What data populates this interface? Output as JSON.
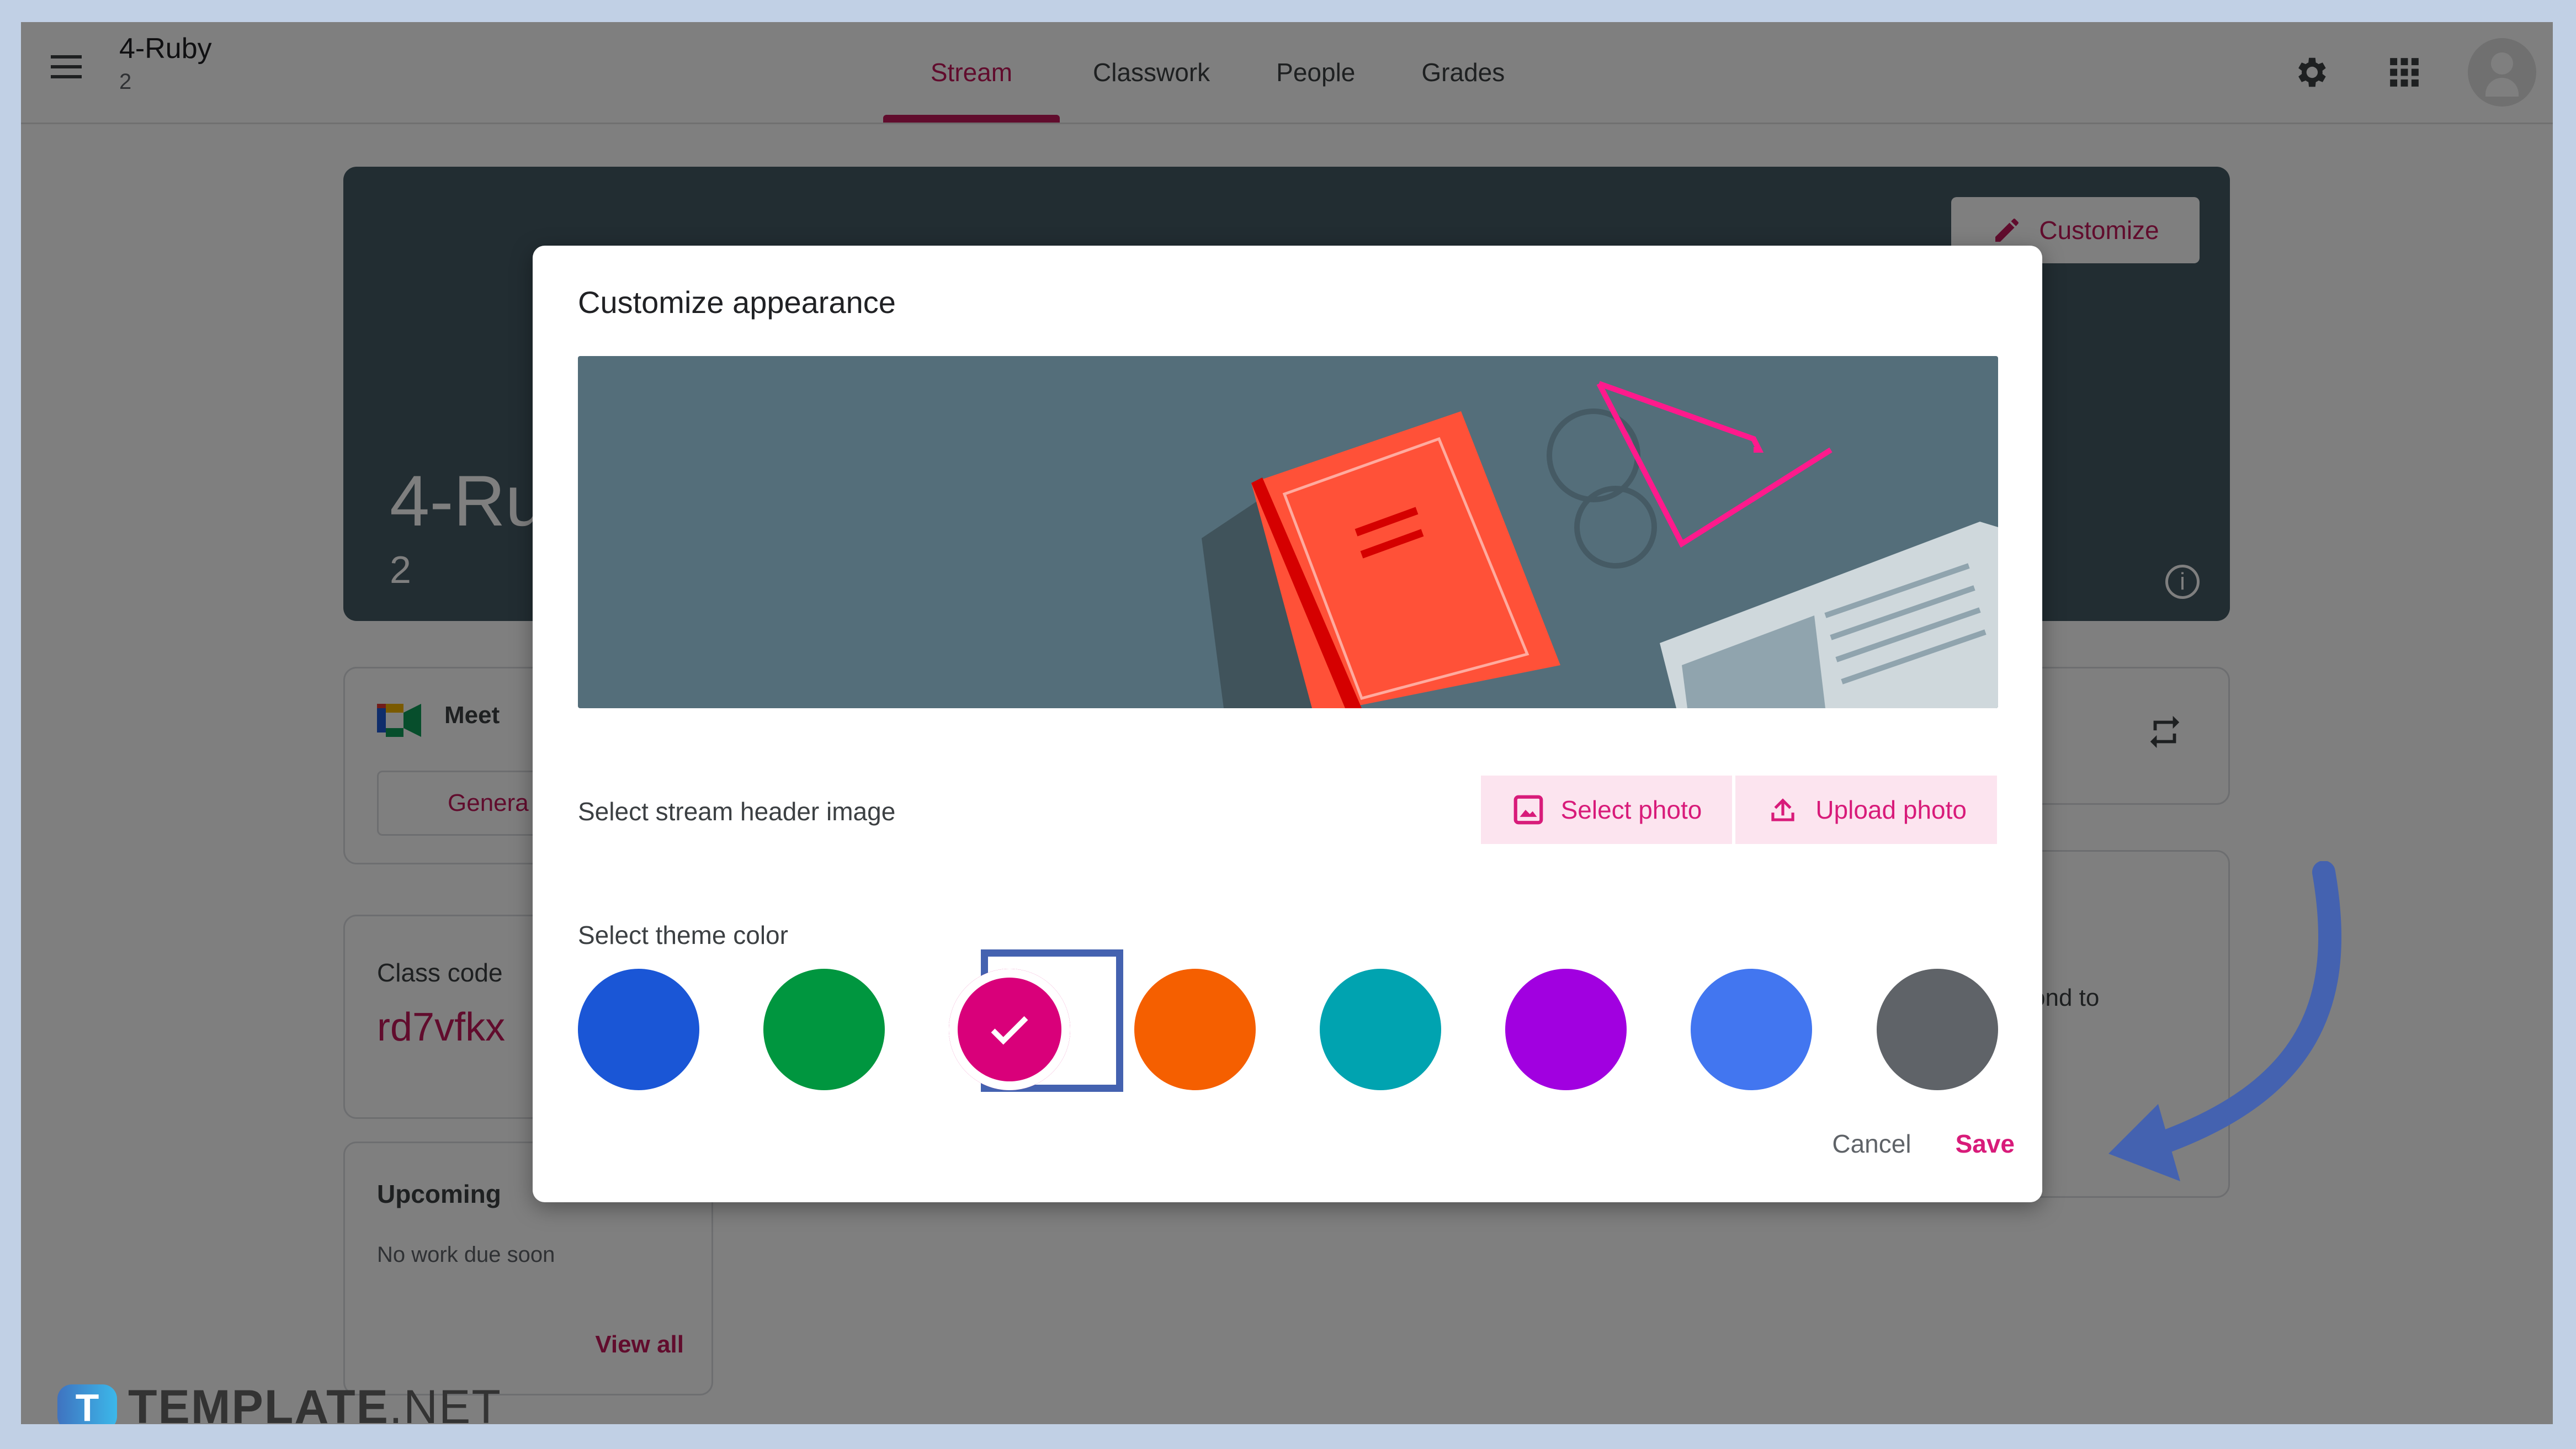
{
  "header": {
    "class_name": "4-Ruby",
    "class_section": "2",
    "tabs": [
      {
        "label": "Stream",
        "active": true
      },
      {
        "label": "Classwork",
        "active": false
      },
      {
        "label": "People",
        "active": false
      },
      {
        "label": "Grades",
        "active": false
      }
    ],
    "icons": [
      "menu-icon",
      "settings-icon",
      "apps-icon",
      "account-avatar"
    ]
  },
  "banner": {
    "title": "4-Ru",
    "section": "2",
    "customize_label": "Customize"
  },
  "sidebar": {
    "meet": {
      "label": "Meet",
      "button_label": "Genera"
    },
    "class_code": {
      "label": "Class code",
      "value": "rd7vfkx"
    },
    "upcoming": {
      "label": "Upcoming",
      "empty_text": "No work due soon",
      "view_all": "View all"
    }
  },
  "right_panel": {
    "partial_text": "ond to"
  },
  "dialog": {
    "title": "Customize appearance",
    "header_image_label": "Select stream header image",
    "select_photo_label": "Select photo",
    "upload_photo_label": "Upload photo",
    "theme_color_label": "Select theme color",
    "theme_colors": [
      {
        "name": "blue",
        "hex": "#1a56d6",
        "selected": false
      },
      {
        "name": "green",
        "hex": "#00963f",
        "selected": false
      },
      {
        "name": "pink",
        "hex": "#d9007a",
        "selected": true
      },
      {
        "name": "orange",
        "hex": "#f55f00",
        "selected": false
      },
      {
        "name": "teal",
        "hex": "#00a3b0",
        "selected": false
      },
      {
        "name": "purple",
        "hex": "#a100e0",
        "selected": false
      },
      {
        "name": "light-blue",
        "hex": "#4276f0",
        "selected": false
      },
      {
        "name": "gray",
        "hex": "#5f6368",
        "selected": false
      }
    ],
    "cancel_label": "Cancel",
    "save_label": "Save"
  },
  "colors": {
    "accent": "#c2185b",
    "annotation": "#4462b0",
    "frame": "#c1d0e5"
  },
  "watermark": {
    "brand_bold": "TEMPLATE",
    "brand_light": ".NET",
    "badge": "T"
  }
}
